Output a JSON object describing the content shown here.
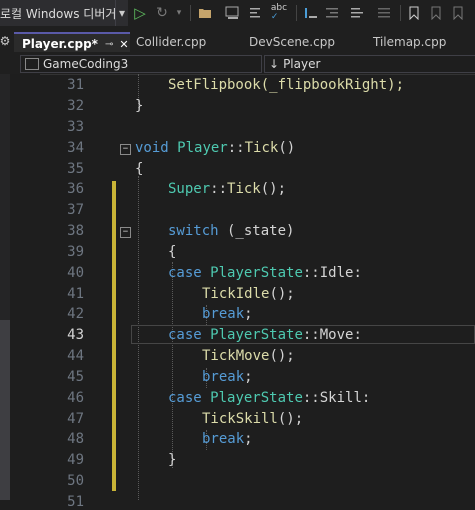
{
  "toolbar": {
    "debugger_label": "로컬 Windows 디버거",
    "dropdown_arrow": "▾",
    "play_icon": "▷",
    "hot_reload_icon": "↻"
  },
  "tabs": [
    {
      "label": "Player.cpp*",
      "pin": "⊸",
      "close": "✕"
    },
    {
      "label": "Collider.cpp"
    },
    {
      "label": "DevScene.cpp"
    },
    {
      "label": "Tilemap.cpp"
    }
  ],
  "settings_icon": "⚙",
  "nav": {
    "project": "GameCoding3",
    "scope": "Player",
    "scope_icon": "↓"
  },
  "line_numbers": [
    "31",
    "32",
    "33",
    "34",
    "35",
    "36",
    "37",
    "38",
    "39",
    "40",
    "41",
    "42",
    "43",
    "44",
    "45",
    "46",
    "47",
    "48",
    "49",
    "50",
    "51"
  ],
  "current_line": "43",
  "code": {
    "l31": "SetFlipbook(_flipbookRight);",
    "l32": "}",
    "l34_void": "void",
    "l34_class": "Player",
    "l34_sep": "::",
    "l34_fn": "Tick",
    "l34_paren": "()",
    "l35": "{",
    "l36_super": "Super",
    "l36_sep": "::",
    "l36_fn": "Tick",
    "l36_rest": "();",
    "l38_kw": "switch",
    "l38_rest": " (_state)",
    "l39": "{",
    "case": "case",
    "enum": "PlayerState",
    "sep": "::",
    "idle": "Idle:",
    "move": "Move:",
    "skill": "Skill:",
    "tickidle": "TickIdle",
    "tickmove": "TickMove",
    "tickskill": "TickSkill",
    "call": "();",
    "brk": "break",
    "semi": ";",
    "l49": "}"
  },
  "fold_symbol": "−"
}
